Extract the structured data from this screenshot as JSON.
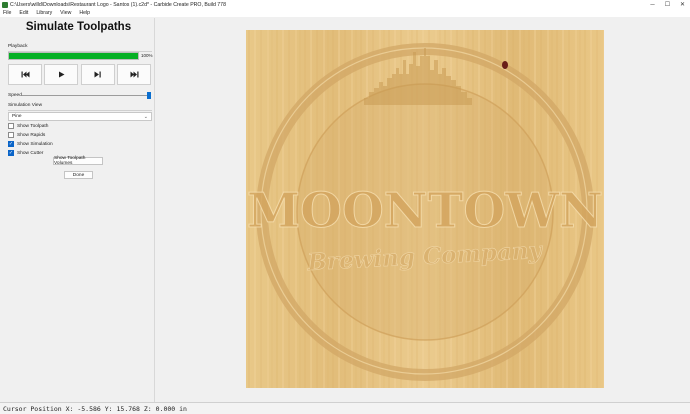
{
  "window": {
    "title": "C:\\Users\\willd\\Downloads\\Restaurant Logo - Santos (1).c2d* - Carbide Create PRO, Build 778",
    "minimize": "─",
    "maximize": "☐",
    "close": "✕"
  },
  "menu": [
    "File",
    "Edit",
    "Library",
    "View",
    "Help"
  ],
  "panel": {
    "title": "Simulate Toolpaths",
    "playback_label": "Playback",
    "progress_percent": 100,
    "progress_text": "100%",
    "speed_label": "Speed",
    "speed_level": 1.0,
    "simulation_view_label": "Simulation View",
    "simulation_view_value": "Pine",
    "checkboxes": [
      {
        "label": "Show Toolpath",
        "checked": false
      },
      {
        "label": "Show Rapids",
        "checked": false
      },
      {
        "label": "Show Simulation",
        "checked": true
      },
      {
        "label": "Show Cutter",
        "checked": true
      }
    ],
    "show_volumes_button": "Show Toolpath Volumes",
    "done_button": "Done"
  },
  "controls": {
    "icons": [
      "skip-to-start-icon",
      "play-icon",
      "skip-to-end-icon",
      "skip-forward-icon"
    ]
  },
  "artwork": {
    "line1": "MOONTOWN",
    "line2": "Brewing Company"
  },
  "status": {
    "text": "Cursor Position X: -5.586 Y: 15.768 Z: 0.000 in"
  },
  "colors": {
    "progress": "#06b025",
    "accent": "#0a64c8",
    "wood": "#e6c283"
  }
}
